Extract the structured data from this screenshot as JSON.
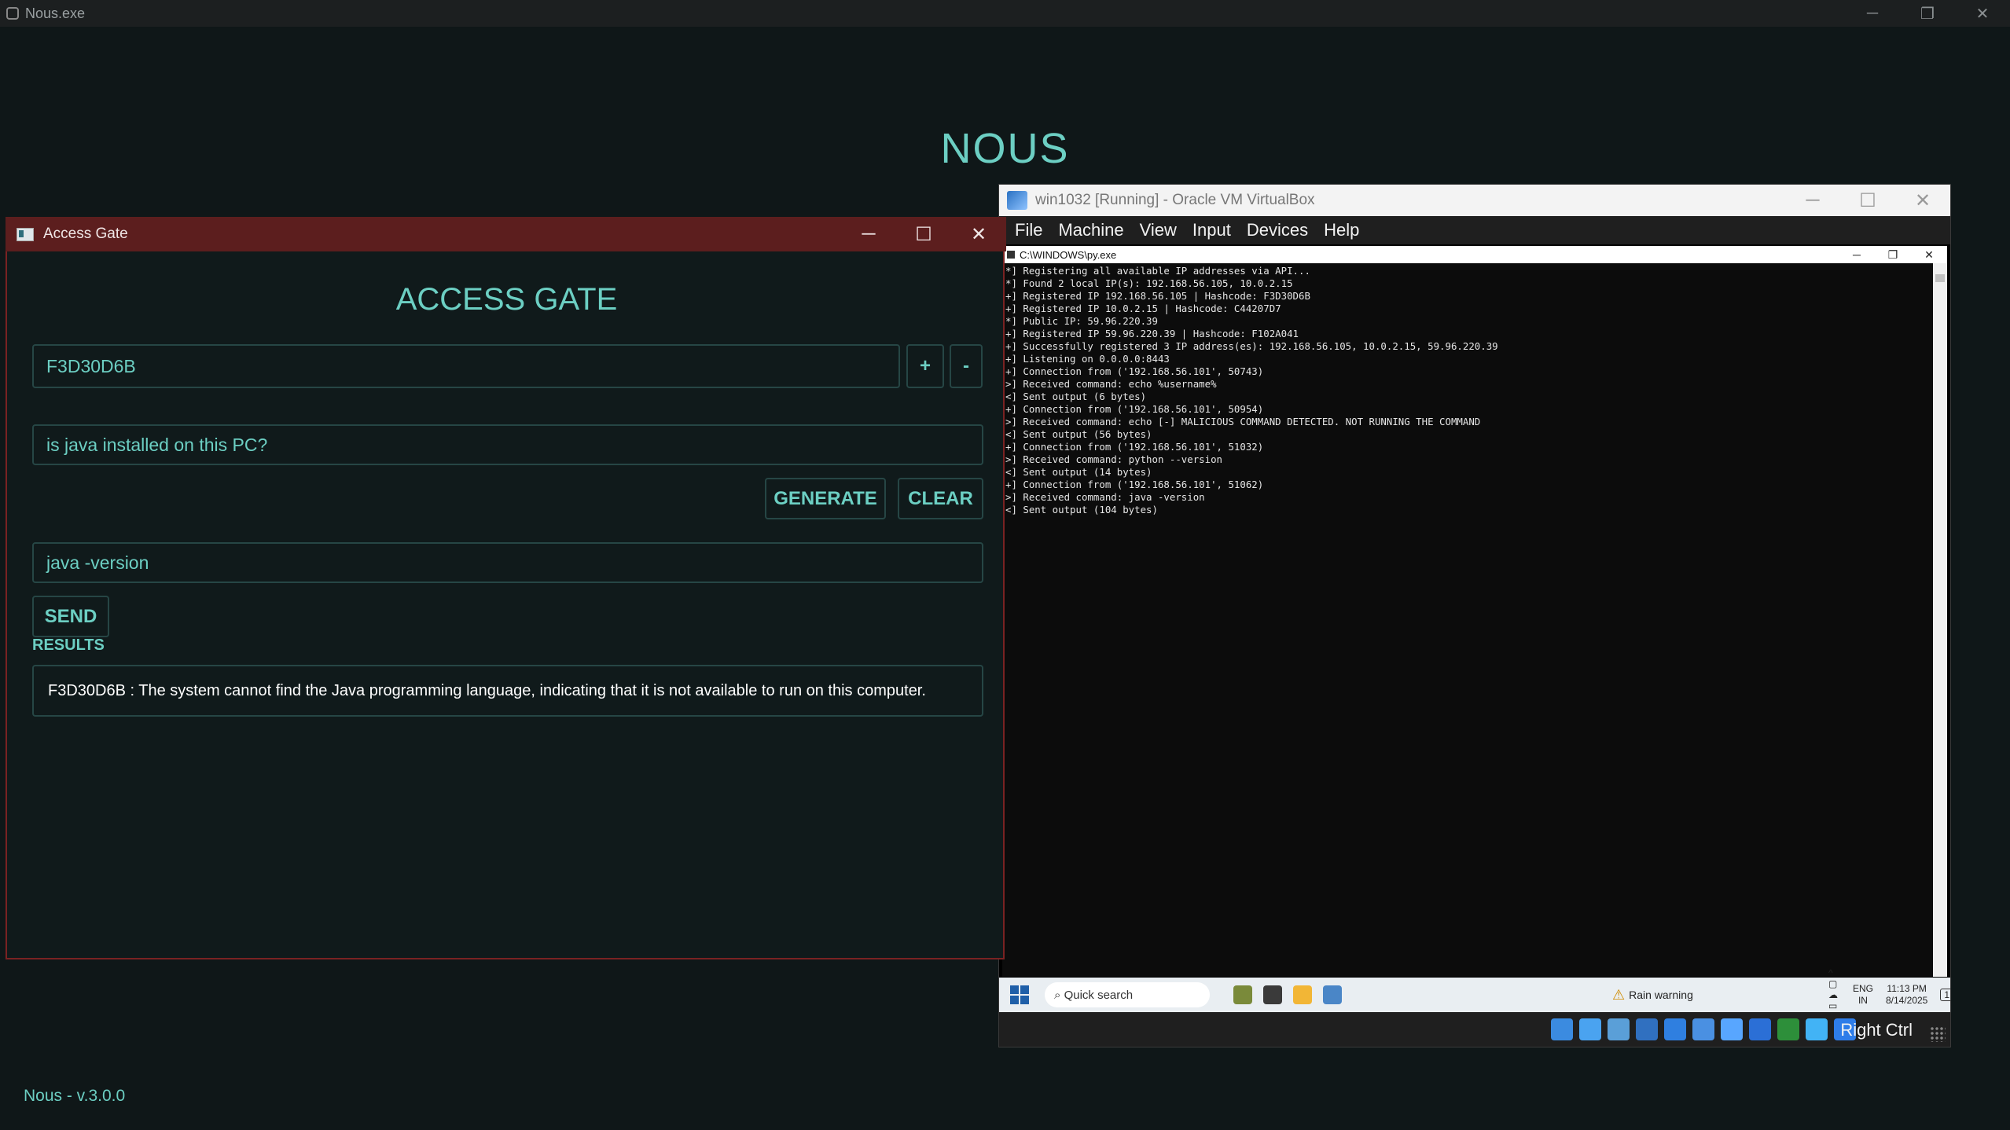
{
  "app": {
    "title": "Nous.exe",
    "heading": "NOUS",
    "version": "Nous - v.3.0.0",
    "caption": {
      "minimize": "─",
      "restore": "❐",
      "close": "✕"
    }
  },
  "access_gate": {
    "window_title": "Access Gate",
    "caption": {
      "minimize": "─",
      "maximize": "☐",
      "close": "✕"
    },
    "heading": "ACCESS GATE",
    "hashcode_value": "F3D30D6B",
    "add_label": "+",
    "remove_label": "-",
    "query_value": "is java installed on this PC?",
    "generate_label": "GENERATE",
    "clear_label": "CLEAR",
    "command_value": "java -version",
    "send_label": "SEND",
    "results_label": "RESULTS",
    "result_text": "F3D30D6B : The system cannot find the Java programming language, indicating that it is not available to run on this computer."
  },
  "vbox": {
    "window_title": "win1032 [Running] - Oracle VM VirtualBox",
    "caption": {
      "minimize": "─",
      "maximize": "☐",
      "close": "✕"
    },
    "menu": [
      "File",
      "Machine",
      "View",
      "Input",
      "Devices",
      "Help"
    ],
    "host_key": "Right Ctrl",
    "status_icon_colors": [
      "#3b8be0",
      "#4aa3f0",
      "#5a9fd8",
      "#3070c0",
      "#2f7fe0",
      "#4a90e2",
      "#58a6ff",
      "#2b6fd6",
      "#2d8f3a",
      "#42b3f5",
      "#2e7de9"
    ]
  },
  "console": {
    "title": "C:\\WINDOWS\\py.exe",
    "caption": {
      "minimize": "─",
      "maximize": "❐",
      "close": "✕"
    },
    "lines": [
      "*] Registering all available IP addresses via API...",
      "*] Found 2 local IP(s): 192.168.56.105, 10.0.2.15",
      "+] Registered IP 192.168.56.105 | Hashcode: F3D30D6B",
      "+] Registered IP 10.0.2.15 | Hashcode: C44207D7",
      "*] Public IP: 59.96.220.39",
      "+] Registered IP 59.96.220.39 | Hashcode: F102A041",
      "+] Successfully registered 3 IP address(es): 192.168.56.105, 10.0.2.15, 59.96.220.39",
      "+] Listening on 0.0.0.0:8443",
      "+] Connection from ('192.168.56.101', 50743)",
      ">] Received command: echo %username%",
      "<] Sent output (6 bytes)",
      "+] Connection from ('192.168.56.101', 50954)",
      ">] Received command: echo [-] MALICIOUS COMMAND DETECTED. NOT RUNNING THE COMMAND",
      "<] Sent output (56 bytes)",
      "+] Connection from ('192.168.56.101', 51032)",
      ">] Received command: python --version",
      "<] Sent output (14 bytes)",
      "+] Connection from ('192.168.56.101', 51062)",
      ">] Received command: java -version",
      "<] Sent output (104 bytes)"
    ]
  },
  "guest_taskbar": {
    "search_placeholder": "Quick search",
    "weather": "Rain warning",
    "lang_line1": "ENG",
    "lang_line2": "IN",
    "time": "11:13 PM",
    "date": "8/14/2025",
    "notification_count": "1"
  }
}
